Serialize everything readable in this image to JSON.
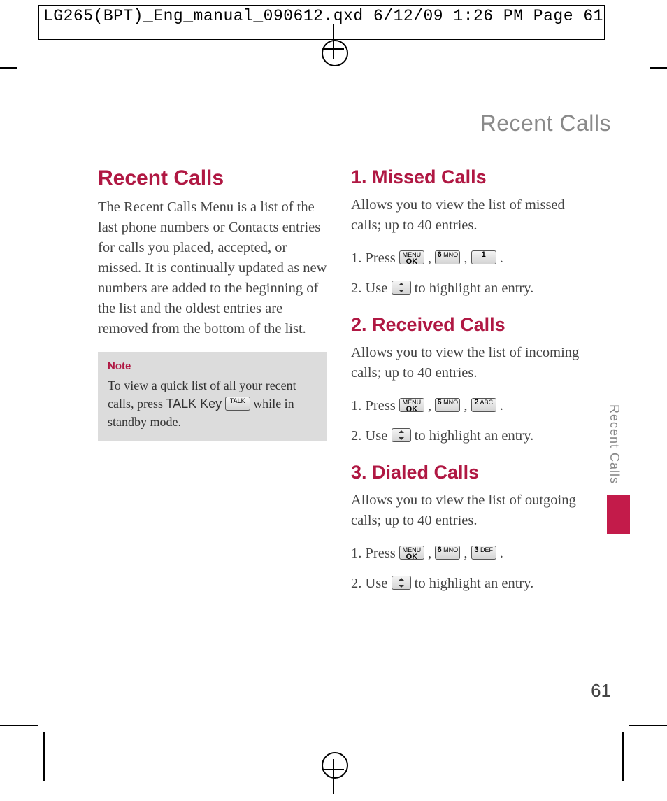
{
  "slug": "LG265(BPT)_Eng_manual_090612.qxd  6/12/09  1:26 PM  Page 61",
  "running_head": "Recent Calls",
  "side_tab": "Recent Calls",
  "page_number": "61",
  "left": {
    "title": "Recent Calls",
    "intro": "The Recent Calls Menu is a list of the last phone numbers or Contacts entries for calls you placed, accepted, or missed. It is continually updated as new numbers are added to the beginning of the list and the oldest entries are removed from the bottom of the list.",
    "note_label": "Note",
    "note_body_pre": "To view a quick list of all your recent calls, press ",
    "note_body_key": "TALK Key",
    "note_body_post": " while in standby mode.",
    "talk_key_label": "TALK"
  },
  "right": {
    "s1_title": "1. Missed Calls",
    "s1_desc": "Allows you to view the list of missed calls; up to 40 entries.",
    "s2_title": "2. Received Calls",
    "s2_desc": "Allows you to view the list of incoming calls; up to 40 entries.",
    "s3_title": "3. Dialed Calls",
    "s3_desc": "Allows you to view the list of outgoing calls; up to 40 entries.",
    "press_label": "1. Press ",
    "use_label_a": "2. Use ",
    "use_label_b": "2.  Use ",
    "highlight_tail": " to highlight an entry.",
    "highlight_tail_wrap": " to highlight an entry.",
    "period": " .",
    "comma": " , "
  },
  "keys": {
    "menu_ok_top": "MENU",
    "menu_ok_bot": "OK",
    "six": "6",
    "six_sub": "MNO",
    "one": "1",
    "one_sub": "",
    "two": "2",
    "two_sub": "ABC",
    "three": "3",
    "three_sub": "DEF"
  }
}
